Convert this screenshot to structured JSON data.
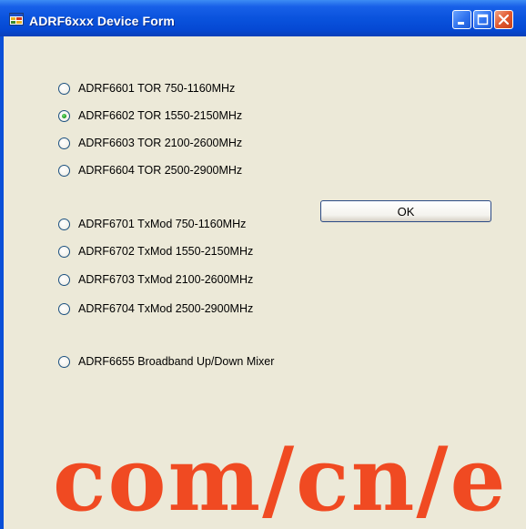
{
  "window": {
    "title": "ADRF6xxx Device Form",
    "title_bar_color": "#0a53dd",
    "controls": {
      "minimize_icon": "minimize-icon",
      "maximize_icon": "maximize-icon",
      "close_icon": "close-icon"
    }
  },
  "form": {
    "background_color": "#ece9d8",
    "options": [
      {
        "label": "ADRF6601 TOR 750-1160MHz",
        "selected": false
      },
      {
        "label": "ADRF6602 TOR 1550-2150MHz",
        "selected": true
      },
      {
        "label": "ADRF6603 TOR 2100-2600MHz",
        "selected": false
      },
      {
        "label": "ADRF6604 TOR 2500-2900MHz",
        "selected": false
      },
      {
        "label": "ADRF6701 TxMod 750-1160MHz",
        "selected": false
      },
      {
        "label": "ADRF6702 TxMod 1550-2150MHz",
        "selected": false
      },
      {
        "label": "ADRF6703 TxMod 2100-2600MHz",
        "selected": false
      },
      {
        "label": "ADRF6704 TxMod 2500-2900MHz",
        "selected": false
      },
      {
        "label": "ADRF6655 Broadband Up/Down Mixer",
        "selected": false
      }
    ],
    "ok_button_label": "OK"
  },
  "watermark": {
    "text": "com/cn/e",
    "color": "#f04a22"
  }
}
